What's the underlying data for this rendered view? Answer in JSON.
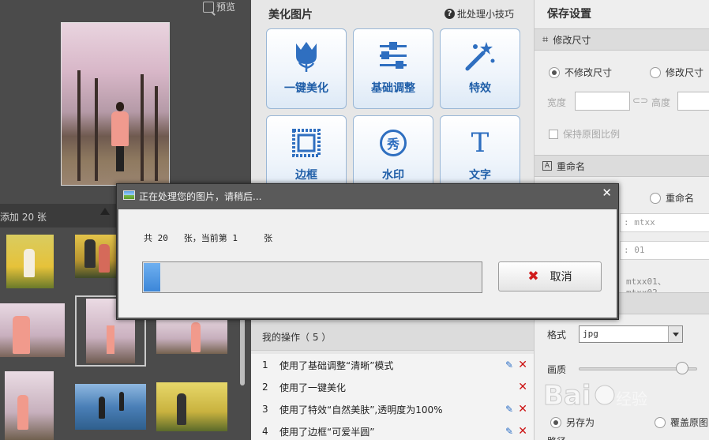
{
  "left": {
    "preview_label": "预览",
    "added_count": "添加 20 张"
  },
  "middle": {
    "title": "美化图片",
    "batch_tip": "批处理小技巧",
    "batch_tip_icon": "?",
    "tools": [
      {
        "label": "一键美化",
        "icon": "tulip-icon"
      },
      {
        "label": "基础调整",
        "icon": "sliders-icon"
      },
      {
        "label": "特效",
        "icon": "magic-wand-icon"
      },
      {
        "label": "边框",
        "icon": "frame-icon"
      },
      {
        "label": "水印",
        "icon": "watermark-icon",
        "glyph": "秀"
      },
      {
        "label": "文字",
        "icon": "text-icon",
        "glyph": "T"
      }
    ],
    "ops_title": "我的操作（ 5 ）",
    "ops": [
      {
        "num": "1",
        "text": "使用了基础调整“清晰”模式",
        "editable": true
      },
      {
        "num": "2",
        "text": "使用了一键美化",
        "editable": false
      },
      {
        "num": "3",
        "text": "使用了特效“自然美肤”,透明度为100%",
        "editable": true
      },
      {
        "num": "4",
        "text": "使用了边框“可爱半圆”",
        "editable": true
      }
    ]
  },
  "right": {
    "title": "保存设置",
    "resize_section": "修改尺寸",
    "no_resize": "不修改尺寸",
    "resize": "修改尺寸",
    "width_label": "宽度",
    "height_label": "高度",
    "keep_ratio": "保持原图比例",
    "rename_section": "重命名",
    "rename": "重命名",
    "prefix_value": ": mtxx",
    "start_value": ": 01",
    "example": "mtxx01、mtxx02...",
    "format_label": "格式",
    "format_value": "jpg",
    "quality_label": "画质",
    "quality": 0.92,
    "save_as": "另存为",
    "overwrite": "覆盖原图",
    "path_label": "路径"
  },
  "dialog": {
    "title": "正在处理您的图片，请稍后...",
    "progress_text": "共 20   张，当前第 1     张",
    "progress": 0.05,
    "cancel": "取消",
    "close": "✕"
  },
  "colors": {
    "accent_blue": "#1f5ea8",
    "delete_red": "#cc1111",
    "progress_blue": "#3c86d8"
  }
}
